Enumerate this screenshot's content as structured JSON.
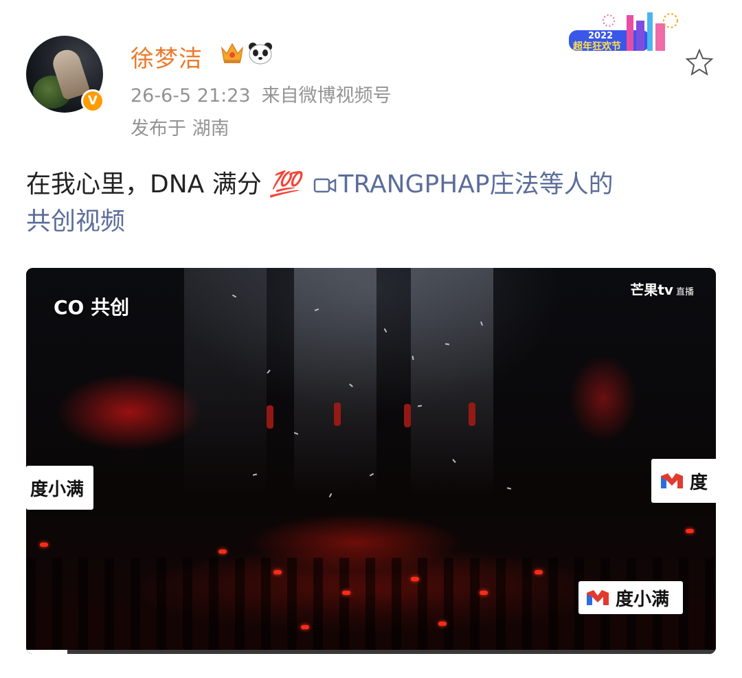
{
  "post": {
    "username": "徐梦洁",
    "timestamp": "26-6-5 21:23",
    "source": "来自微博视频号",
    "location": "发布于 湖南",
    "badge_year": "2022",
    "badge_text": "超年狂欢节",
    "text_main": "在我心里，DNA 满分",
    "emoji_100": "💯",
    "link_text": "TRANGPHAP庄法等人的",
    "link_text_2": "共创视频"
  },
  "video": {
    "co_label": "CO 共创",
    "brand": "芒果tv",
    "brand_sub": "直播",
    "sign_left": "度小满",
    "sign_right": "度",
    "sign_bottom": "度小满",
    "progress": 0.06
  },
  "icons": [
    "crown-icon",
    "panda-icon",
    "verified-icon",
    "star-icon",
    "camera-icon"
  ],
  "colors": {
    "username": "#eb7a2b",
    "link": "#5b6d9a",
    "meta": "#939393"
  }
}
